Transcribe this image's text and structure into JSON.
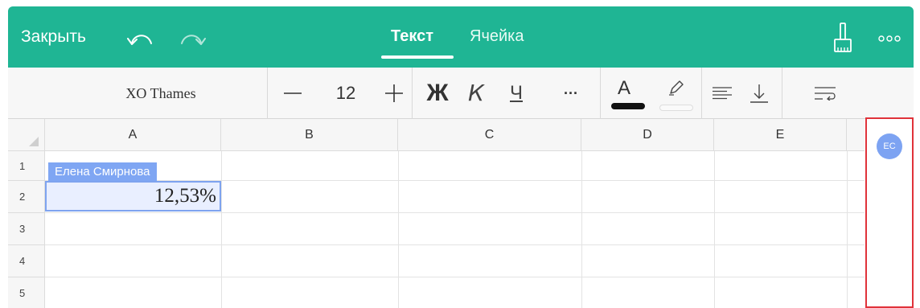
{
  "header": {
    "close_label": "Закрыть",
    "tabs": [
      {
        "label": "Текст",
        "active": true
      },
      {
        "label": "Ячейка",
        "active": false
      }
    ]
  },
  "format_toolbar": {
    "font_name": "XO Thames",
    "font_size": "12",
    "bold_label": "Ж",
    "italic_label": "К",
    "underline_label": "Ч",
    "more_label": "···",
    "text_color_label": "A"
  },
  "columns": [
    "A",
    "B",
    "C",
    "D",
    "E"
  ],
  "rows": [
    "1",
    "2",
    "3",
    "4",
    "5"
  ],
  "cells": {
    "A2": "12,53%"
  },
  "collaborator": {
    "tag_name": "Елена Смирнова",
    "initials": "EC",
    "color": "#7da3f2"
  },
  "colors": {
    "accent": "#1fb594",
    "selection_border": "#7ea3ef",
    "panel_highlight": "#e0323a"
  },
  "icons": [
    "undo-icon",
    "redo-icon",
    "brush-icon",
    "more-icon",
    "minus-icon",
    "plus-icon",
    "highlighter-icon",
    "align-icon",
    "vertical-align-icon",
    "wrap-icon"
  ]
}
